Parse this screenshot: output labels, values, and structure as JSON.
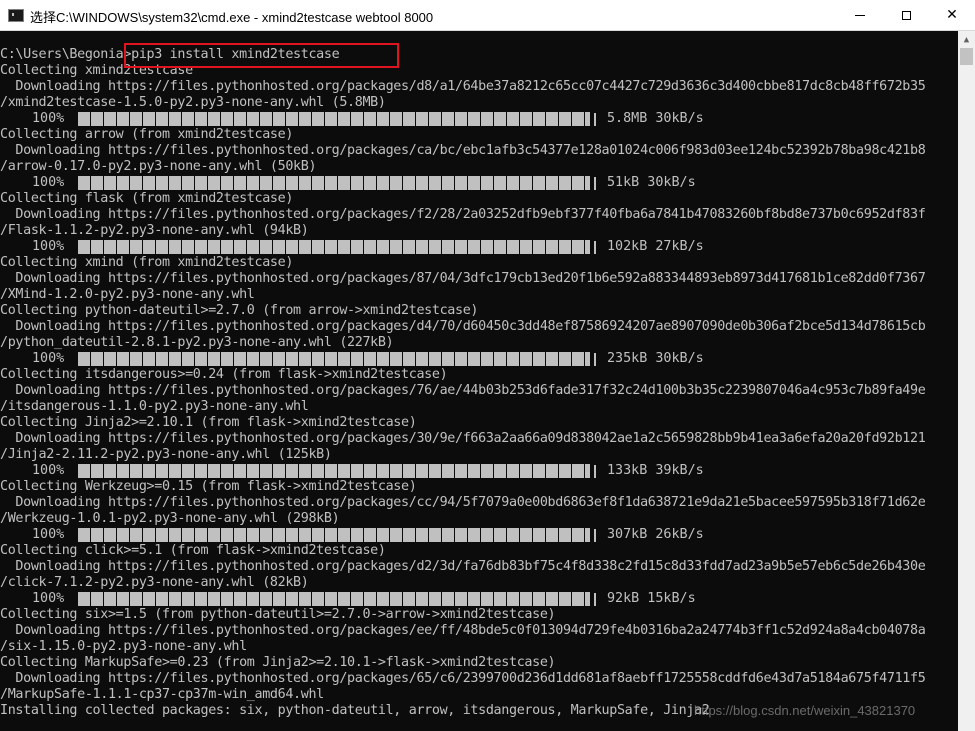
{
  "window": {
    "icon": "cmd-icon",
    "title": "选择C:\\WINDOWS\\system32\\cmd.exe - xmind2testcase  webtool 8000",
    "min_icon": "minimize-icon",
    "max_icon": "maximize-icon",
    "close_label": "✕"
  },
  "console": {
    "lines": [
      "C:\\Users\\Begonia>pip3 install xmind2testcase",
      "Collecting xmind2testcase",
      "  Downloading https://files.pythonhosted.org/packages/d8/a1/64be37a8212c65cc07c4427c729d3636c3d400cbbe817dc8cb48ff672b35",
      "/xmind2testcase-1.5.0-py2.py3-none-any.whl (5.8MB)",
      "",
      "Collecting arrow (from xmind2testcase)",
      "  Downloading https://files.pythonhosted.org/packages/ca/bc/ebc1afb3c54377e128a01024c006f983d03ee124bc52392b78ba98c421b8",
      "/arrow-0.17.0-py2.py3-none-any.whl (50kB)",
      "",
      "Collecting flask (from xmind2testcase)",
      "  Downloading https://files.pythonhosted.org/packages/f2/28/2a03252dfb9ebf377f40fba6a7841b47083260bf8bd8e737b0c6952df83f",
      "/Flask-1.1.2-py2.py3-none-any.whl (94kB)",
      "",
      "Collecting xmind (from xmind2testcase)",
      "  Downloading https://files.pythonhosted.org/packages/87/04/3dfc179cb13ed20f1b6e592a883344893eb8973d417681b1ce82dd0f7367",
      "/XMind-1.2.0-py2.py3-none-any.whl",
      "Collecting python-dateutil>=2.7.0 (from arrow->xmind2testcase)",
      "  Downloading https://files.pythonhosted.org/packages/d4/70/d60450c3dd48ef87586924207ae8907090de0b306af2bce5d134d78615cb",
      "/python_dateutil-2.8.1-py2.py3-none-any.whl (227kB)",
      "",
      "Collecting itsdangerous>=0.24 (from flask->xmind2testcase)",
      "  Downloading https://files.pythonhosted.org/packages/76/ae/44b03b253d6fade317f32c24d100b3b35c2239807046a4c953c7b89fa49e",
      "/itsdangerous-1.1.0-py2.py3-none-any.whl",
      "Collecting Jinja2>=2.10.1 (from flask->xmind2testcase)",
      "  Downloading https://files.pythonhosted.org/packages/30/9e/f663a2aa66a09d838042ae1a2c5659828bb9b41ea3a6efa20a20fd92b121",
      "/Jinja2-2.11.2-py2.py3-none-any.whl (125kB)",
      "",
      "Collecting Werkzeug>=0.15 (from flask->xmind2testcase)",
      "  Downloading https://files.pythonhosted.org/packages/cc/94/5f7079a0e00bd6863ef8f1da638721e9da21e5bacee597595b318f71d62e",
      "/Werkzeug-1.0.1-py2.py3-none-any.whl (298kB)",
      "",
      "Collecting click>=5.1 (from flask->xmind2testcase)",
      "  Downloading https://files.pythonhosted.org/packages/d2/3d/fa76db83bf75c4f8d338c2fd15c8d33fdd7ad23a9b5e57eb6c5de26b430e",
      "/click-7.1.2-py2.py3-none-any.whl (82kB)",
      "",
      "Collecting six>=1.5 (from python-dateutil>=2.7.0->arrow->xmind2testcase)",
      "  Downloading https://files.pythonhosted.org/packages/ee/ff/48bde5c0f013094d729fe4b0316ba2a24774b3ff1c52d924a8a4cb04078a",
      "/six-1.15.0-py2.py3-none-any.whl",
      "Collecting MarkupSafe>=0.23 (from Jinja2>=2.10.1->flask->xmind2testcase)",
      "  Downloading https://files.pythonhosted.org/packages/65/c6/2399700d236d1dd681af8aebff1725558cddfd6e43d7a5184a675f4711f5",
      "/MarkupSafe-1.1.1-cp37-cp37m-win_amd64.whl",
      "Installing collected packages: six, python-dateutil, arrow, itsdangerous, MarkupSafe, Jinja2"
    ],
    "progress": [
      {
        "line": 4,
        "percent": "100%",
        "stats": "5.8MB 30kB/s",
        "fraction": 1.0
      },
      {
        "line": 8,
        "percent": "100%",
        "stats": "51kB 30kB/s",
        "fraction": 1.0
      },
      {
        "line": 12,
        "percent": "100%",
        "stats": "102kB 27kB/s",
        "fraction": 1.0
      },
      {
        "line": 19,
        "percent": "100%",
        "stats": "235kB 30kB/s",
        "fraction": 1.0
      },
      {
        "line": 26,
        "percent": "100%",
        "stats": "133kB 39kB/s",
        "fraction": 1.0
      },
      {
        "line": 30,
        "percent": "100%",
        "stats": "307kB 26kB/s",
        "fraction": 1.0
      },
      {
        "line": 34,
        "percent": "100%",
        "stats": "92kB 15kB/s",
        "fraction": 1.0
      }
    ]
  },
  "watermark": "https://blog.csdn.net/weixin_43821370",
  "colors": {
    "console_bg": "#0c0c0c",
    "console_fg": "#c0c0c0",
    "highlight": "#e0141e"
  }
}
